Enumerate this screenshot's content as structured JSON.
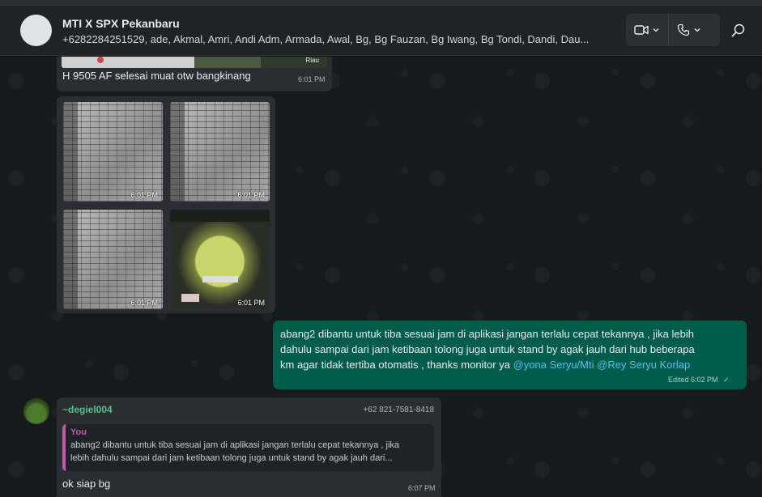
{
  "header": {
    "title": "MTI X SPX Pekanbaru",
    "members": "+6282284251529, ade, Akmal, Amri, Andi Adm, Armada, Awal, Bg, Bg Fauzan, Bg Iwang, Bg Tondi, Dandi, Dau..."
  },
  "top_image": {
    "watermark": "Riau"
  },
  "messages": {
    "m1": {
      "text": "H 9505 AF selesai muat otw bangkinang",
      "time": "6:01 PM"
    },
    "images": [
      {
        "time": "6:01 PM"
      },
      {
        "time": "6:01 PM"
      },
      {
        "time": "6:01 PM"
      },
      {
        "time": "6:01 PM"
      }
    ],
    "m2": {
      "line1": "abang2 dibantu untuk tiba sesuai jam di aplikasi jangan terlalu cepat tekannya , jika lebih",
      "line2": "dahulu sampai dari jam ketibaan tolong juga untuk stand by agak jauh dari hub beberapa",
      "line3": "km agar tidak tertiba otomatis , thanks monitor ya",
      "mention1": "@yona Seryu/Mti",
      "mention2": "@Rey Seryu Korlap",
      "edited": "Edited 6:02 PM",
      "tick": "✓"
    },
    "m3": {
      "sender": "~degiel004",
      "phone": "+62 821-7581-8418",
      "quote_author": "You",
      "quote_line1": "abang2 dibantu untuk tiba sesuai jam di aplikasi jangan terlalu cepat tekannya , jika",
      "quote_line2": "lebih dahulu sampai dari jam ketibaan tolong juga untuk stand by agak jauh dari...",
      "text": "ok siap bg",
      "time": "6:07 PM"
    }
  },
  "colors": {
    "incoming": "#2a2e32",
    "outgoing": "#005c4b",
    "mention": "#53bdeb",
    "sender": "#53c28b",
    "quote_bar": "#c05ab0"
  },
  "icons": [
    "video-icon",
    "phone-icon",
    "chevron-down-icon",
    "search-icon"
  ]
}
